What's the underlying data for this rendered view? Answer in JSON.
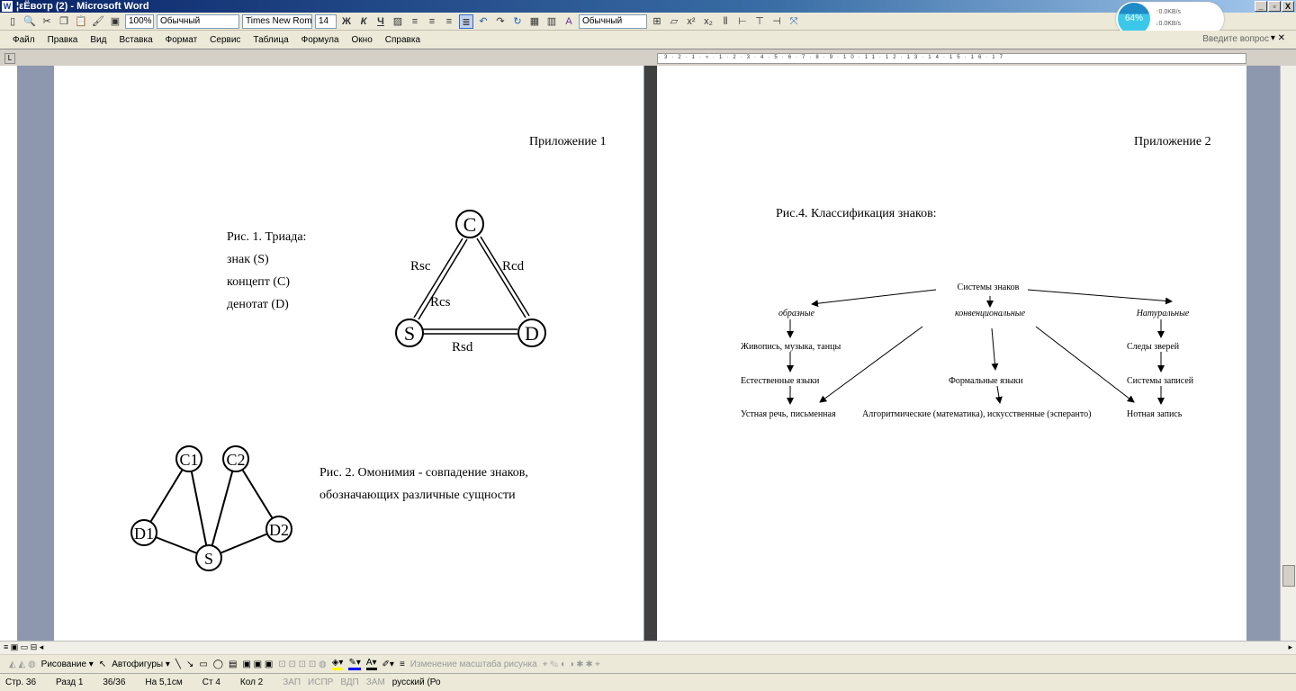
{
  "window": {
    "title": "¦εЁвотр (2) - Microsoft Word",
    "buttons": [
      "_",
      "▫",
      "X"
    ]
  },
  "toolbar": {
    "zoom": "100%",
    "style": "Обычный",
    "font": "Times New Roman",
    "size": "14",
    "bold": "Ж",
    "italic": "К",
    "underline": "Ч",
    "style2": "Обычный"
  },
  "menu": [
    "Файл",
    "Правка",
    "Вид",
    "Вставка",
    "Формат",
    "Сервис",
    "Таблица",
    "Формула",
    "Окно",
    "Справка"
  ],
  "help_placeholder": "Введите вопрос",
  "network": {
    "percent": "64%",
    "up": "0.0KB/s",
    "down": "0.0KB/s"
  },
  "page1": {
    "heading": "Приложение 1",
    "fig1": {
      "caption": [
        "Рис. 1. Триада:",
        "знак (S)",
        "концепт (C)",
        "денотат (D)"
      ],
      "nodes": [
        "C",
        "S",
        "D"
      ],
      "labels": [
        "Rsc",
        "Rcd",
        "Rcs",
        "Rsd"
      ]
    },
    "fig2": {
      "caption": [
        "Рис. 2. Омонимия - совпадение знаков,",
        "обозначающих различные сущности"
      ],
      "nodes": [
        "C1",
        "C2",
        "D1",
        "D2",
        "S"
      ]
    }
  },
  "page2": {
    "heading": "Приложение 2",
    "caption": "Рис.4. Классификация знаков:",
    "tree": {
      "root": "Системы знаков",
      "branches": [
        "образные",
        "конвенциональные",
        "Натуральные"
      ],
      "items": [
        "Живопись, музыка, танцы",
        "Естественные языки",
        "Устная речь, письменная",
        "Формальные языки",
        "Алгоритмические (математика), искусственные (эсперанто)",
        "Следы зверей",
        "Системы записей",
        "Нотная запись"
      ]
    }
  },
  "drawbar": {
    "draw": "Рисование ▾",
    "autoshapes": "Автофигуры ▾",
    "scale": "Изменение масштаба рисунка"
  },
  "status": {
    "page": "Стр. 36",
    "section": "Разд 1",
    "pages": "36/36",
    "at": "На 5,1см",
    "line": "Ст 4",
    "col": "Кол 2",
    "rec": "ЗАП",
    "trk": "ИСПР",
    "ext": "ВДП",
    "ovr": "ЗАМ",
    "lang": "русский (Ро"
  }
}
